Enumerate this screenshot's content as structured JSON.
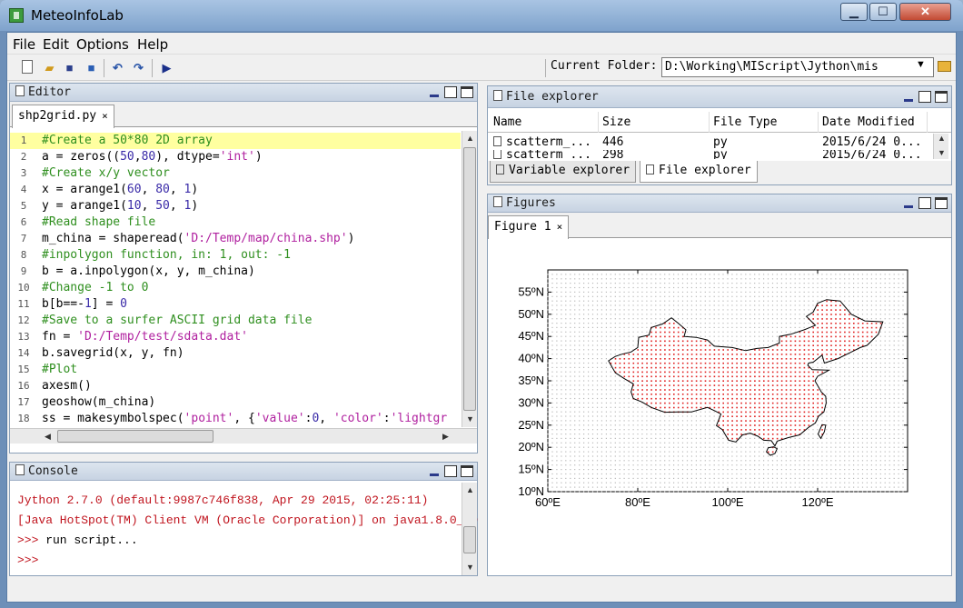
{
  "window": {
    "title": "MeteoInfoLab"
  },
  "menu": [
    "File",
    "Edit",
    "Options",
    "Help"
  ],
  "toolbar": {
    "current_folder_label": "Current Folder:",
    "current_folder_value": "D:\\Working\\MIScript\\Jython\\mis"
  },
  "editor": {
    "title": "Editor",
    "tab": "shp2grid.py",
    "lines": [
      {
        "n": "1",
        "segs": [
          [
            "cm",
            "#Create a 50*80 2D array"
          ]
        ]
      },
      {
        "n": "2",
        "segs": [
          [
            "",
            "a = zeros(("
          ],
          [
            "nm",
            "50"
          ],
          [
            "",
            ","
          ],
          [
            "nm",
            "80"
          ],
          [
            "",
            "), dtype="
          ],
          [
            "st",
            "'int'"
          ],
          [
            "",
            ")"
          ]
        ]
      },
      {
        "n": "3",
        "segs": [
          [
            "cm",
            "#Create x/y vector"
          ]
        ]
      },
      {
        "n": "4",
        "segs": [
          [
            "",
            "x = arange1("
          ],
          [
            "nm",
            "60"
          ],
          [
            "",
            ", "
          ],
          [
            "nm",
            "80"
          ],
          [
            "",
            ", "
          ],
          [
            "nm",
            "1"
          ],
          [
            "",
            ")"
          ]
        ]
      },
      {
        "n": "5",
        "segs": [
          [
            "",
            "y = arange1("
          ],
          [
            "nm",
            "10"
          ],
          [
            "",
            ", "
          ],
          [
            "nm",
            "50"
          ],
          [
            "",
            ", "
          ],
          [
            "nm",
            "1"
          ],
          [
            "",
            ")"
          ]
        ]
      },
      {
        "n": "6",
        "segs": [
          [
            "cm",
            "#Read shape file"
          ]
        ]
      },
      {
        "n": "7",
        "segs": [
          [
            "",
            "m_china = shaperead("
          ],
          [
            "st",
            "'D:/Temp/map/china.shp'"
          ],
          [
            "",
            ")"
          ]
        ]
      },
      {
        "n": "8",
        "segs": [
          [
            "cm",
            "#inpolygon function, in: 1, out: -1"
          ]
        ]
      },
      {
        "n": "9",
        "segs": [
          [
            "",
            "b = a.inpolygon(x, y, m_china)"
          ]
        ]
      },
      {
        "n": "10",
        "segs": [
          [
            "cm",
            "#Change -1 to 0"
          ]
        ]
      },
      {
        "n": "11",
        "segs": [
          [
            "",
            "b[b==-"
          ],
          [
            "nm",
            "1"
          ],
          [
            "",
            "] = "
          ],
          [
            "nm",
            "0"
          ]
        ]
      },
      {
        "n": "12",
        "segs": [
          [
            "cm",
            "#Save to a surfer ASCII grid data file"
          ]
        ]
      },
      {
        "n": "13",
        "segs": [
          [
            "",
            "fn = "
          ],
          [
            "st",
            "'D:/Temp/test/sdata.dat'"
          ]
        ]
      },
      {
        "n": "14",
        "segs": [
          [
            "",
            "b.savegrid(x, y, fn)"
          ]
        ]
      },
      {
        "n": "15",
        "segs": [
          [
            "cm",
            "#Plot"
          ]
        ]
      },
      {
        "n": "16",
        "segs": [
          [
            "",
            "axesm()"
          ]
        ]
      },
      {
        "n": "17",
        "segs": [
          [
            "",
            "geoshow(m_china)"
          ]
        ]
      },
      {
        "n": "18",
        "segs": [
          [
            "",
            "ss = makesymbolspec("
          ],
          [
            "st",
            "'point'"
          ],
          [
            "",
            ", {"
          ],
          [
            "st",
            "'value'"
          ],
          [
            "",
            ":"
          ],
          [
            "nm",
            "0"
          ],
          [
            "",
            ", "
          ],
          [
            "st",
            "'color'"
          ],
          [
            "",
            ":"
          ],
          [
            "st",
            "'lightgr"
          ]
        ]
      }
    ]
  },
  "console": {
    "title": "Console",
    "lines": [
      {
        "text": "Jython 2.7.0 (default:9987c746f838, Apr 29 2015, 02:25:11)",
        "color": "#c0141e"
      },
      {
        "text": "[Java HotSpot(TM) Client VM (Oracle Corporation)] on java1.8.0_40",
        "color": "#c0141e"
      },
      {
        "text": ">>> run script...",
        "color": "#000000",
        "prompt": ">>>",
        "rest": " run script..."
      },
      {
        "text": ">>>",
        "color": "#c0141e"
      }
    ]
  },
  "file_explorer": {
    "title": "File explorer",
    "columns": [
      "Name",
      "Size",
      "File Type",
      "Date Modified"
    ],
    "rows": [
      [
        "scatterm_...",
        "446",
        "py",
        "2015/6/24 0..."
      ],
      [
        "scatterm_...",
        "298",
        "py",
        "2015/6/24 0..."
      ]
    ],
    "bottom_tabs": [
      "Variable explorer",
      "File explorer"
    ]
  },
  "figures": {
    "title": "Figures",
    "tab": "Figure 1",
    "chart_data": {
      "type": "scatter",
      "title": "",
      "xlabel": "",
      "ylabel": "",
      "xlim": [
        60,
        140
      ],
      "ylim": [
        10,
        60
      ],
      "xticks": [
        "60ºE",
        "80ºE",
        "100ºE",
        "120ºE"
      ],
      "yticks": [
        "10ºN",
        "15ºN",
        "20ºN",
        "25ºN",
        "30ºN",
        "35ºN",
        "40ºN",
        "45ºN",
        "50ºN",
        "55ºN"
      ],
      "grid_spacing": 1,
      "colors": {
        "outside": "#b8b8b8",
        "inside": "#e02020",
        "outline": "#000000"
      },
      "polygon": [
        [
          73.5,
          39.5
        ],
        [
          75,
          40.5
        ],
        [
          76.5,
          41
        ],
        [
          78.5,
          41.5
        ],
        [
          80,
          42.5
        ],
        [
          80.2,
          44.8
        ],
        [
          82.5,
          45.3
        ],
        [
          83,
          47
        ],
        [
          85.5,
          47.8
        ],
        [
          87.5,
          49.2
        ],
        [
          89,
          48
        ],
        [
          90.7,
          46.5
        ],
        [
          90.3,
          45
        ],
        [
          93,
          44.8
        ],
        [
          95.5,
          44.2
        ],
        [
          97,
          42.8
        ],
        [
          101,
          42.5
        ],
        [
          104,
          41.8
        ],
        [
          106.5,
          42.3
        ],
        [
          109,
          42.5
        ],
        [
          111.5,
          43.5
        ],
        [
          111.5,
          45
        ],
        [
          114,
          45.5
        ],
        [
          117,
          46.5
        ],
        [
          119.5,
          47.5
        ],
        [
          117.5,
          49.5
        ],
        [
          119,
          50.5
        ],
        [
          120,
          52.5
        ],
        [
          122,
          53.3
        ],
        [
          125,
          53
        ],
        [
          127.5,
          50
        ],
        [
          130.5,
          48.5
        ],
        [
          134.5,
          48.3
        ],
        [
          133.5,
          45.5
        ],
        [
          131,
          43
        ],
        [
          129.5,
          42.5
        ],
        [
          127.5,
          41.5
        ],
        [
          124.5,
          40
        ],
        [
          121.5,
          39
        ],
        [
          121,
          40.8
        ],
        [
          119,
          39.2
        ],
        [
          118,
          39
        ],
        [
          117.8,
          38.5
        ],
        [
          118.8,
          37.5
        ],
        [
          122.5,
          37.4
        ],
        [
          120,
          36
        ],
        [
          119.4,
          35
        ],
        [
          120.8,
          32.5
        ],
        [
          121.8,
          31.5
        ],
        [
          121.9,
          30
        ],
        [
          121.4,
          28
        ],
        [
          120.2,
          27
        ],
        [
          119.5,
          25.5
        ],
        [
          118,
          24.5
        ],
        [
          116,
          22.8
        ],
        [
          113.5,
          22.2
        ],
        [
          111,
          21.4
        ],
        [
          110.5,
          20.3
        ],
        [
          109.7,
          21.5
        ],
        [
          108,
          21.6
        ],
        [
          106.7,
          22.5
        ],
        [
          105,
          23.2
        ],
        [
          103.3,
          22.8
        ],
        [
          101.8,
          21.2
        ],
        [
          100.2,
          21.6
        ],
        [
          98.8,
          24
        ],
        [
          97.5,
          24.9
        ],
        [
          98.5,
          27.5
        ],
        [
          97.2,
          28.2
        ],
        [
          95.5,
          29
        ],
        [
          92,
          28
        ],
        [
          89,
          28
        ],
        [
          86,
          27.9
        ],
        [
          83,
          29
        ],
        [
          81,
          30.2
        ],
        [
          79,
          31
        ],
        [
          78.5,
          32.5
        ],
        [
          79,
          34.3
        ],
        [
          77,
          35.5
        ],
        [
          75,
          36.8
        ],
        [
          73.5,
          39.5
        ]
      ],
      "island": [
        [
          108.6,
          19
        ],
        [
          109.5,
          18.2
        ],
        [
          110.5,
          18.6
        ],
        [
          111,
          19.7
        ],
        [
          110.2,
          20.1
        ],
        [
          109,
          19.9
        ],
        [
          108.6,
          19
        ]
      ],
      "taiwan": [
        [
          120.1,
          23
        ],
        [
          120.7,
          22
        ],
        [
          121.5,
          23.5
        ],
        [
          121.8,
          25
        ],
        [
          121,
          25.1
        ],
        [
          120.1,
          23
        ]
      ]
    }
  }
}
